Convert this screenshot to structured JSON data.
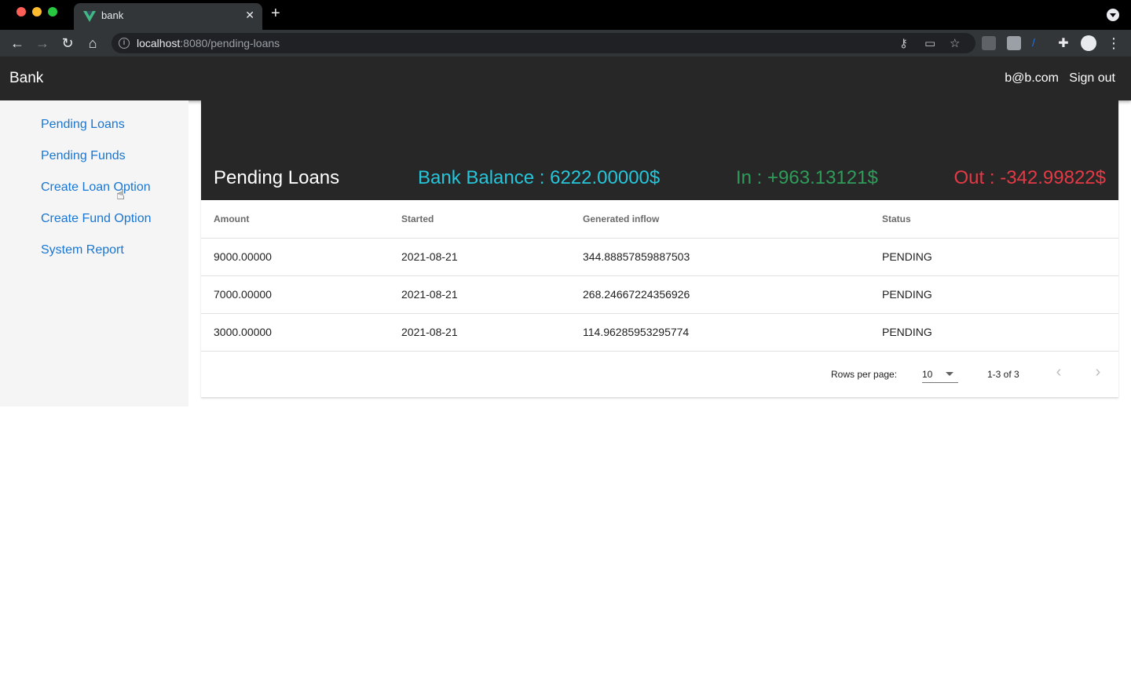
{
  "browser": {
    "tab_title": "bank",
    "url_host": "localhost",
    "url_path": ":8080/pending-loans"
  },
  "header": {
    "brand": "Bank",
    "user_email": "b@b.com",
    "signout_label": "Sign out"
  },
  "sidebar": {
    "items": [
      {
        "label": "Pending Loans"
      },
      {
        "label": "Pending Funds"
      },
      {
        "label": "Create Loan Option"
      },
      {
        "label": "Create Fund Option"
      },
      {
        "label": "System Report"
      }
    ]
  },
  "summary": {
    "title": "Pending Loans",
    "balance": "Bank Balance : 6222.00000$",
    "inflow": "In : +963.13121$",
    "outflow": "Out : -342.99822$"
  },
  "table": {
    "headers": [
      "Amount",
      "Started",
      "Generated inflow",
      "Status"
    ],
    "rows": [
      [
        "9000.00000",
        "2021-08-21",
        "344.88857859887503",
        "PENDING"
      ],
      [
        "7000.00000",
        "2021-08-21",
        "268.24667224356926",
        "PENDING"
      ],
      [
        "3000.00000",
        "2021-08-21",
        "114.96285953295774",
        "PENDING"
      ]
    ]
  },
  "pagination": {
    "rows_per_page_label": "Rows per page:",
    "rows_per_page_value": "10",
    "page_info": "1-3 of 3"
  },
  "colors": {
    "balance": "#26c6da",
    "inflow": "#2e9d5a",
    "outflow": "#e53946",
    "link": "#1976d2"
  }
}
